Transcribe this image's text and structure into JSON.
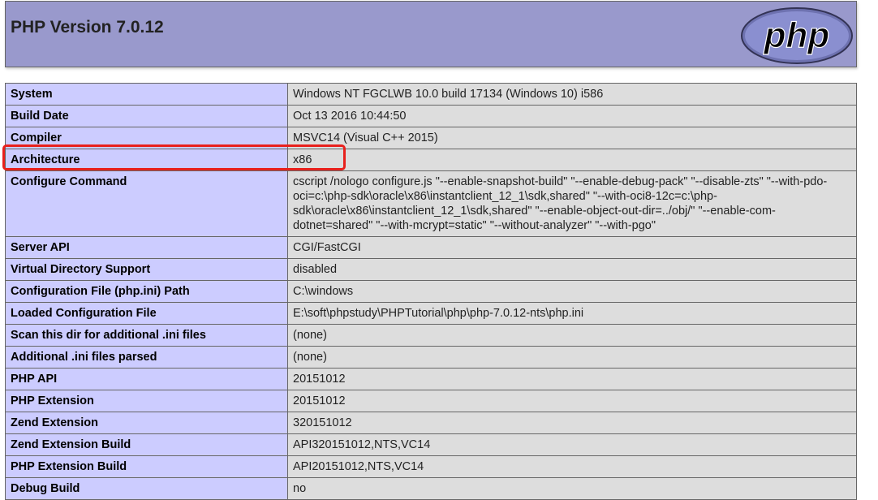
{
  "header": {
    "title": "PHP Version 7.0.12",
    "logo_text": "php",
    "logo_icon": "php-logo"
  },
  "rows": [
    {
      "key": "System",
      "value": "Windows NT FGCLWB 10.0 build 17134 (Windows 10) i586"
    },
    {
      "key": "Build Date",
      "value": "Oct 13 2016 10:44:50"
    },
    {
      "key": "Compiler",
      "value": "MSVC14 (Visual C++ 2015)"
    },
    {
      "key": "Architecture",
      "value": "x86"
    },
    {
      "key": "Configure Command",
      "value": "cscript /nologo configure.js \"--enable-snapshot-build\" \"--enable-debug-pack\" \"--disable-zts\" \"--with-pdo-oci=c:\\php-sdk\\oracle\\x86\\instantclient_12_1\\sdk,shared\" \"--with-oci8-12c=c:\\php-sdk\\oracle\\x86\\instantclient_12_1\\sdk,shared\" \"--enable-object-out-dir=../obj/\" \"--enable-com-dotnet=shared\" \"--with-mcrypt=static\" \"--without-analyzer\" \"--with-pgo\""
    },
    {
      "key": "Server API",
      "value": "CGI/FastCGI"
    },
    {
      "key": "Virtual Directory Support",
      "value": "disabled"
    },
    {
      "key": "Configuration File (php.ini) Path",
      "value": "C:\\windows"
    },
    {
      "key": "Loaded Configuration File",
      "value": "E:\\soft\\phpstudy\\PHPTutorial\\php\\php-7.0.12-nts\\php.ini"
    },
    {
      "key": "Scan this dir for additional .ini files",
      "value": "(none)"
    },
    {
      "key": "Additional .ini files parsed",
      "value": "(none)"
    },
    {
      "key": "PHP API",
      "value": "20151012"
    },
    {
      "key": "PHP Extension",
      "value": "20151012"
    },
    {
      "key": "Zend Extension",
      "value": "320151012"
    },
    {
      "key": "Zend Extension Build",
      "value": "API320151012,NTS,VC14"
    },
    {
      "key": "PHP Extension Build",
      "value": "API20151012,NTS,VC14"
    },
    {
      "key": "Debug Build",
      "value": "no"
    }
  ],
  "colors": {
    "header_bg": "#9999cc",
    "key_bg": "#ccccff",
    "value_bg": "#dddddd",
    "highlight": "#e8201c"
  }
}
